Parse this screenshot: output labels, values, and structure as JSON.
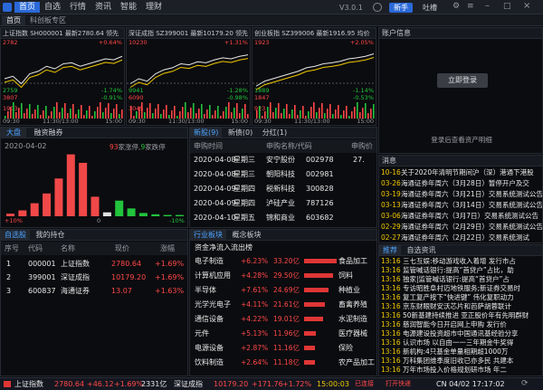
{
  "app": {
    "version": "V3.0.1",
    "menus": [
      "首页",
      "自选",
      "行情",
      "资讯",
      "智能",
      "理财"
    ],
    "btn_new": "新手",
    "btn_feedback": "吐槽"
  },
  "subtabs": [
    "首页",
    "科创板专区"
  ],
  "minicharts": [
    {
      "title": "上证指数 SH000001 最新2780.64 领先",
      "hi": "2782",
      "lo": "2759",
      "pct_up": "+0.64%",
      "pct_dn": "-0.91%",
      "pct_mid": "-1.74%",
      "vol": "3807",
      "vol2": "1903",
      "time_start": "09:30",
      "time_mid": "11:30/13:00",
      "time_end": "15:00"
    },
    {
      "title": "深证成指 SZ399001 最新10179.20 领先",
      "hi": "10230",
      "lo": "9941",
      "pct_up": "+1.31%",
      "pct_dn": "-0.98%",
      "pct_mid": "-1.28%",
      "vol": "6090",
      "vol2": "3045",
      "time_start": "09:30",
      "time_mid": "11:30/13:00",
      "time_end": "15:00"
    },
    {
      "title": "创业板指 SZ399006 最新1916.95 均价",
      "hi": "1923",
      "lo": "1889",
      "pct_up": "+2.05%",
      "pct_dn": "-0.53%",
      "pct_mid": "-1.14%",
      "vol": "1847",
      "vol2": "923",
      "time_start": "09:30",
      "time_mid": "11:30/13:00",
      "time_end": "15:00"
    }
  ],
  "account": {
    "title": "账户信息",
    "login": "立即登录",
    "hint": "登录后查看资产明细"
  },
  "dapan": {
    "tab1": "大盘",
    "tab2": "融资融券",
    "date": "2020-04-02",
    "up_count": "93",
    "up_text": "家涨停,",
    "down_count": "9",
    "down_text": "家跌停",
    "left_label": "+10%",
    "mid_label": "0",
    "right_label": "-10%",
    "bars": [
      {
        "v": 0.04,
        "c": "red"
      },
      {
        "v": 0.09,
        "c": "red"
      },
      {
        "v": 0.2,
        "c": "red"
      },
      {
        "v": 0.35,
        "c": "red"
      },
      {
        "v": 0.58,
        "c": "red"
      },
      {
        "v": 0.95,
        "c": "red"
      },
      {
        "v": 0.82,
        "c": "red"
      },
      {
        "v": 0.3,
        "c": "red"
      },
      {
        "v": 0.06,
        "c": "white"
      },
      {
        "v": 0.24,
        "c": "green"
      },
      {
        "v": 0.12,
        "c": "green"
      },
      {
        "v": 0.05,
        "c": "green"
      },
      {
        "v": 0.03,
        "c": "green"
      },
      {
        "v": 0.02,
        "c": "green"
      },
      {
        "v": 0.02,
        "c": "green"
      }
    ]
  },
  "ipo": {
    "tabs": [
      "新股(9)",
      "新债(0)",
      "分红(1)"
    ],
    "headers": [
      "申购时间",
      "申购名称/代码",
      "申购价"
    ],
    "rows": [
      [
        "2020-04-08",
        "星期三",
        "安宁股份",
        "002978",
        "27."
      ],
      [
        "2020-04-08",
        "星期三",
        "朝阳科技",
        "002981",
        ""
      ],
      [
        "2020-04-09",
        "星期四",
        "税新科技",
        "300828",
        ""
      ],
      [
        "2020-04-09",
        "星期四",
        "泸硅产业",
        "787126",
        ""
      ],
      [
        "2020-04-10",
        "星期五",
        "锦和商业",
        "603682",
        ""
      ]
    ]
  },
  "notices": {
    "title": "消息",
    "rows": [
      [
        "10-16",
        "关于2020年清明节期间沪（深）港通下港股"
      ],
      [
        "03-26",
        "海通证券年周六（3月28日）暂停开户及交"
      ],
      [
        "03-19",
        "海通证券年周六（3月21日）交易系统测试公告"
      ],
      [
        "03-13",
        "海通证券年周六（3月14日）交易系统测试公告"
      ],
      [
        "03-06",
        "海通证券年周六（3月7日）交易系统测试公告"
      ],
      [
        "02-29",
        "海通证券年周六（2月29日）交易系统测试公告"
      ],
      [
        "02-27",
        "海通证券年周六（2月22日）交易系统测试"
      ]
    ]
  },
  "watch": {
    "tabs": [
      "自选股",
      "我的持仓"
    ],
    "headers": [
      "序号",
      "代码",
      "名称",
      "现价",
      "涨幅"
    ],
    "rows": [
      [
        "1",
        "000001",
        "上证指数",
        "2780.64",
        "+1.69%"
      ],
      [
        "2",
        "399001",
        "深证成指",
        "10179.20",
        "+1.69%"
      ],
      [
        "3",
        "600837",
        "海通证券",
        "13.07",
        "+1.63%"
      ]
    ]
  },
  "industry": {
    "tabs": [
      "行业板块",
      "概念板块"
    ],
    "subtitle": "资金净流入流出榜",
    "rows": [
      {
        "name": "电子制造",
        "pct": "+6.23%",
        "amt": "33.20亿",
        "v": 1.0,
        "side": "食品加工"
      },
      {
        "name": "计算机应用",
        "pct": "+4.28%",
        "amt": "29.50亿",
        "v": 0.89,
        "side": "饲料"
      },
      {
        "name": "半导体",
        "pct": "+7.61%",
        "amt": "24.69亿",
        "v": 0.74,
        "side": "种植业"
      },
      {
        "name": "光学光电子",
        "pct": "+4.11%",
        "amt": "21.61亿",
        "v": 0.65,
        "side": "畜禽养殖"
      },
      {
        "name": "通信设备",
        "pct": "+4.22%",
        "amt": "19.01亿",
        "v": 0.57,
        "side": "水泥制造"
      },
      {
        "name": "元件",
        "pct": "+5.13%",
        "amt": "11.96亿",
        "v": 0.36,
        "side": "医疗器械"
      },
      {
        "name": "电源设备",
        "pct": "+2.87%",
        "amt": "11.16亿",
        "v": 0.34,
        "side": "保险"
      },
      {
        "name": "饮料制造",
        "pct": "+2.64%",
        "amt": "11.18亿",
        "v": 0.34,
        "side": "农产品加工"
      }
    ]
  },
  "livenews": {
    "tabs": [
      "推荐",
      "自选资讯"
    ],
    "rows": [
      [
        "13:16",
        "三七互娱:移动游戏收入着增 发行市占"
      ],
      [
        "13:16",
        "监管喊话银行:提高“首贷户”占比，助"
      ],
      [
        "13:16",
        "独家|监管喊话银行:提高“首贷户”占"
      ],
      [
        "13:16",
        "专访昭胜阜村迈地铁服务;新证券交易时"
      ],
      [
        "13:16",
        "复工复产按下“快进键” 伟化复职动力"
      ],
      [
        "13:16",
        "京东财眼财安沃芯片和芭萨胡蓉联计"
      ],
      [
        "13:16",
        "50新基建持续推进 亚正股价年有先明群财"
      ],
      [
        "13:16",
        "慈润智能今日开启网上申购 发行价"
      ],
      [
        "13:16",
        "电源建设投资超市中国通讯基经验分享"
      ],
      [
        "13:16",
        "认识市场 以自由一一三年期金牛奖得"
      ],
      [
        "13:16",
        "新机构:4只基金单量相期超1000万"
      ],
      [
        "13:16",
        "万科集团维季度旧收已亦多民 共建本"
      ],
      [
        "13:16",
        "万年市场投入价格规划研市场 年二"
      ]
    ]
  },
  "ticker": {
    "idx1": "上证指数",
    "idx1_val": "2780.64",
    "idx1_chg": "+46.12",
    "idx1_pct": "+1.69%",
    "idx1_amt": "2331亿",
    "idx2": "深证成指",
    "idx2_val": "10179.20",
    "idx2_chg": "+171.76",
    "idx2_pct": "+1.72%",
    "time": "15:00:03",
    "conn1": "已连接",
    "conn2": "打开快递",
    "date": "CN 04/02 17:17:02"
  }
}
